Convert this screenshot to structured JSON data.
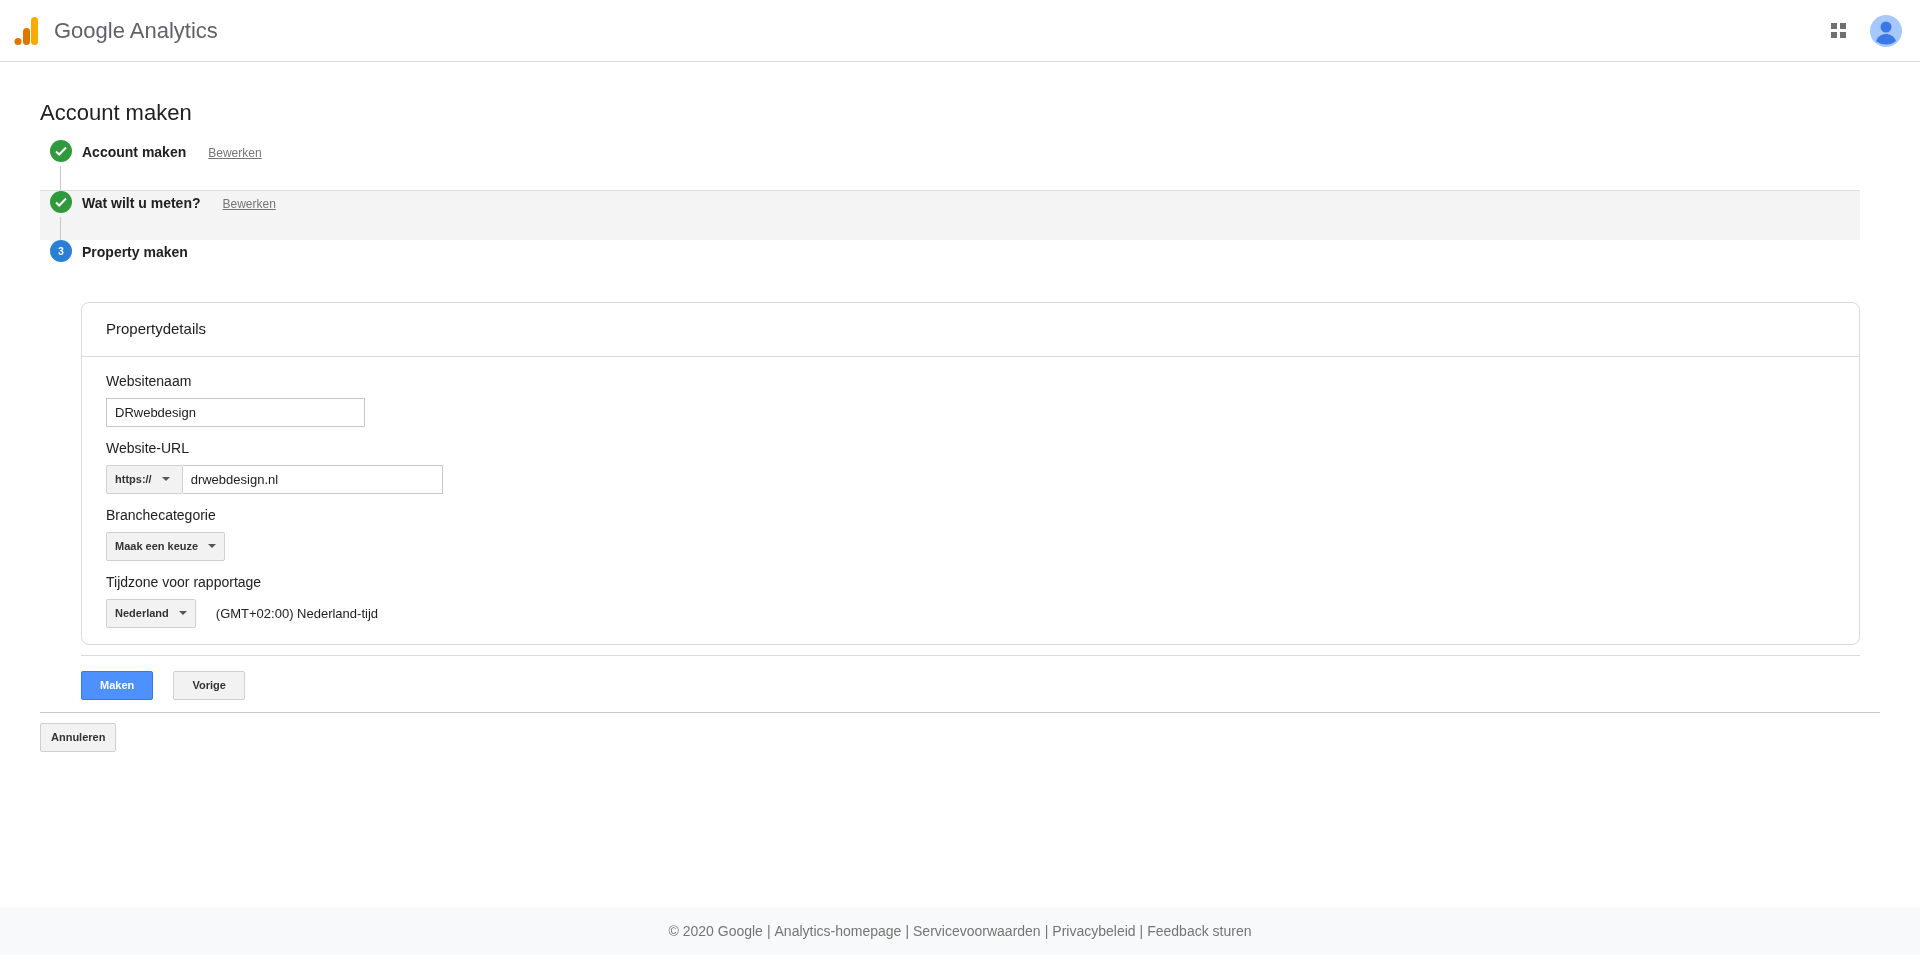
{
  "header": {
    "title": "Google Analytics"
  },
  "page_title": "Account maken",
  "steps": [
    {
      "label": "Account maken",
      "kind": "done",
      "edit_link": "Bewerken",
      "highlighted": false
    },
    {
      "label": "Wat wilt u meten?",
      "kind": "done",
      "edit_link": "Bewerken",
      "highlighted": true
    },
    {
      "label": "Property maken",
      "kind": "current",
      "number": "3",
      "highlighted": false
    }
  ],
  "card": {
    "title": "Propertydetails",
    "fields": [
      {
        "kind": "text",
        "label": "Websitenaam",
        "value": "DRwebdesign"
      },
      {
        "kind": "url",
        "label": "Website-URL",
        "prefix": "https://",
        "value": "drwebdesign.nl"
      },
      {
        "kind": "select",
        "label": "Branchecategorie",
        "value": "Maak een keuze"
      },
      {
        "kind": "select",
        "label": "Tijdzone voor rapportage",
        "value": "Nederland",
        "note": "(GMT+02:00) Nederland-tijd"
      }
    ]
  },
  "buttons": [
    {
      "label": "Maken",
      "primary": true
    },
    {
      "label": "Vorige",
      "primary": false
    }
  ],
  "cancel_button": "Annuleren",
  "footer": [
    {
      "kind": "text",
      "text": "© 2020 Google"
    },
    {
      "kind": "separator",
      "text": "|"
    },
    {
      "kind": "link",
      "text": "Analytics-homepage"
    },
    {
      "kind": "separator",
      "text": "|"
    },
    {
      "kind": "link",
      "text": "Servicevoorwaarden"
    },
    {
      "kind": "separator",
      "text": "|"
    },
    {
      "kind": "link",
      "text": "Privacybeleid"
    },
    {
      "kind": "separator",
      "text": "|"
    },
    {
      "kind": "link",
      "text": "Feedback sturen"
    }
  ]
}
